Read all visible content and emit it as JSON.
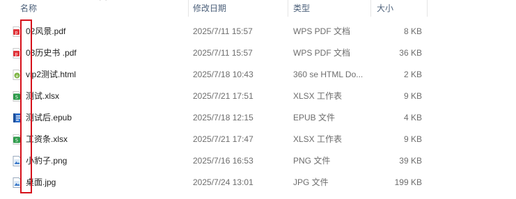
{
  "columns": {
    "name": "名称",
    "modified": "修改日期",
    "type": "类型",
    "size": "大小"
  },
  "files": [
    {
      "name": "02风景.pdf",
      "modified": "2025/7/11 15:57",
      "type": "WPS PDF 文档",
      "size": "8 KB",
      "icon": "pdf-file-icon"
    },
    {
      "name": "03历史书 .pdf",
      "modified": "2025/7/11 15:57",
      "type": "WPS PDF 文档",
      "size": "36 KB",
      "icon": "pdf-file-icon"
    },
    {
      "name": "vip2测试.html",
      "modified": "2025/7/18 10:43",
      "type": "360 se HTML Do...",
      "size": "2 KB",
      "icon": "html-file-icon"
    },
    {
      "name": "测试.xlsx",
      "modified": "2025/7/21 17:51",
      "type": "XLSX 工作表",
      "size": "9 KB",
      "icon": "xlsx-file-icon"
    },
    {
      "name": "测试后.epub",
      "modified": "2025/7/18 12:15",
      "type": "EPUB 文件",
      "size": "4 KB",
      "icon": "epub-file-icon"
    },
    {
      "name": "工资条.xlsx",
      "modified": "2025/7/21 17:47",
      "type": "XLSX 工作表",
      "size": "9 KB",
      "icon": "xlsx-file-icon"
    },
    {
      "name": "小豹子.png",
      "modified": "2025/7/16 16:53",
      "type": "PNG 文件",
      "size": "39 KB",
      "icon": "image-file-icon"
    },
    {
      "name": "桌面.jpg",
      "modified": "2025/7/24 13:01",
      "type": "JPG 文件",
      "size": "199 KB",
      "icon": "image-file-icon"
    }
  ],
  "colors": {
    "highlight_box": "#d6101a",
    "pdf_icon": "#e0343a",
    "html_icon": "#7cb342",
    "xlsx_icon": "#2e9a4a",
    "epub_icon": "#2f6fc9",
    "image_icon": "#3a78c8"
  }
}
